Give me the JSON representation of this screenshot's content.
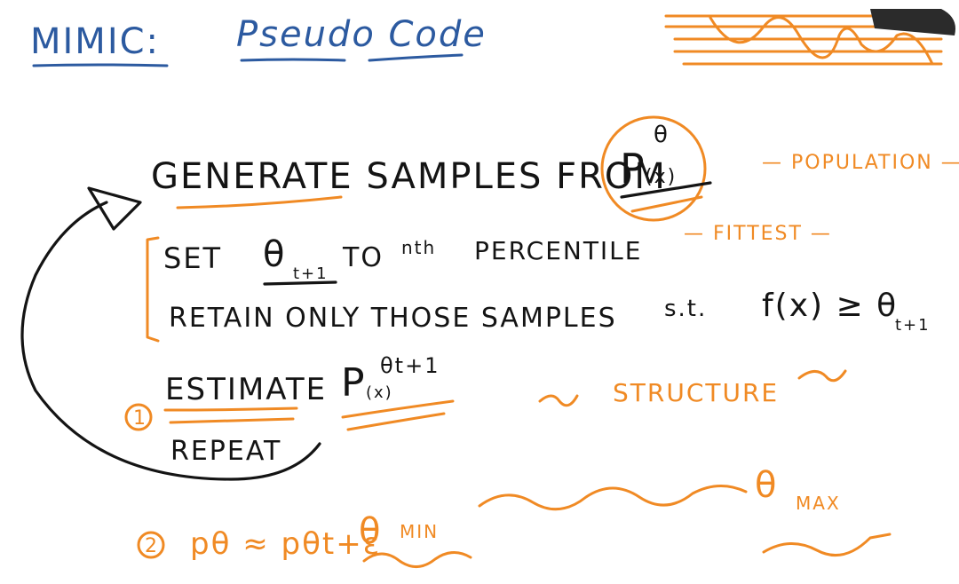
{
  "title": {
    "left": "MIMIC:",
    "right": "Pseudo Code"
  },
  "steps": {
    "generate": {
      "prefix": "GENERATE SAMPLES FROM",
      "p": "P",
      "x": "(x)",
      "theta": "θ"
    },
    "set": {
      "prefix": "SET",
      "theta_sub": "t+1",
      "suffix": "TO",
      "nth": "nth",
      "percentile": "PERCENTILE"
    },
    "retain": {
      "text": "RETAIN ONLY THOSE SAMPLES",
      "st": "s.t.",
      "expr": "f(x) ≥ θ",
      "sub": "t+1"
    },
    "estimate": {
      "prefix": "ESTIMATE",
      "p": "P",
      "x": "(x)",
      "theta_sup": "θt+1"
    },
    "repeat": "REPEAT"
  },
  "notes": {
    "population": "— POPULATION —",
    "fittest": "— FITTEST —",
    "structure": "STRUCTURE",
    "circle_one": "1",
    "circle_two": "2",
    "approx_left": "pθ ≈ pθt+ε",
    "theta_min": "θ",
    "min_sub": "MIN",
    "theta_max": "θ",
    "max_sub": "MAX"
  }
}
